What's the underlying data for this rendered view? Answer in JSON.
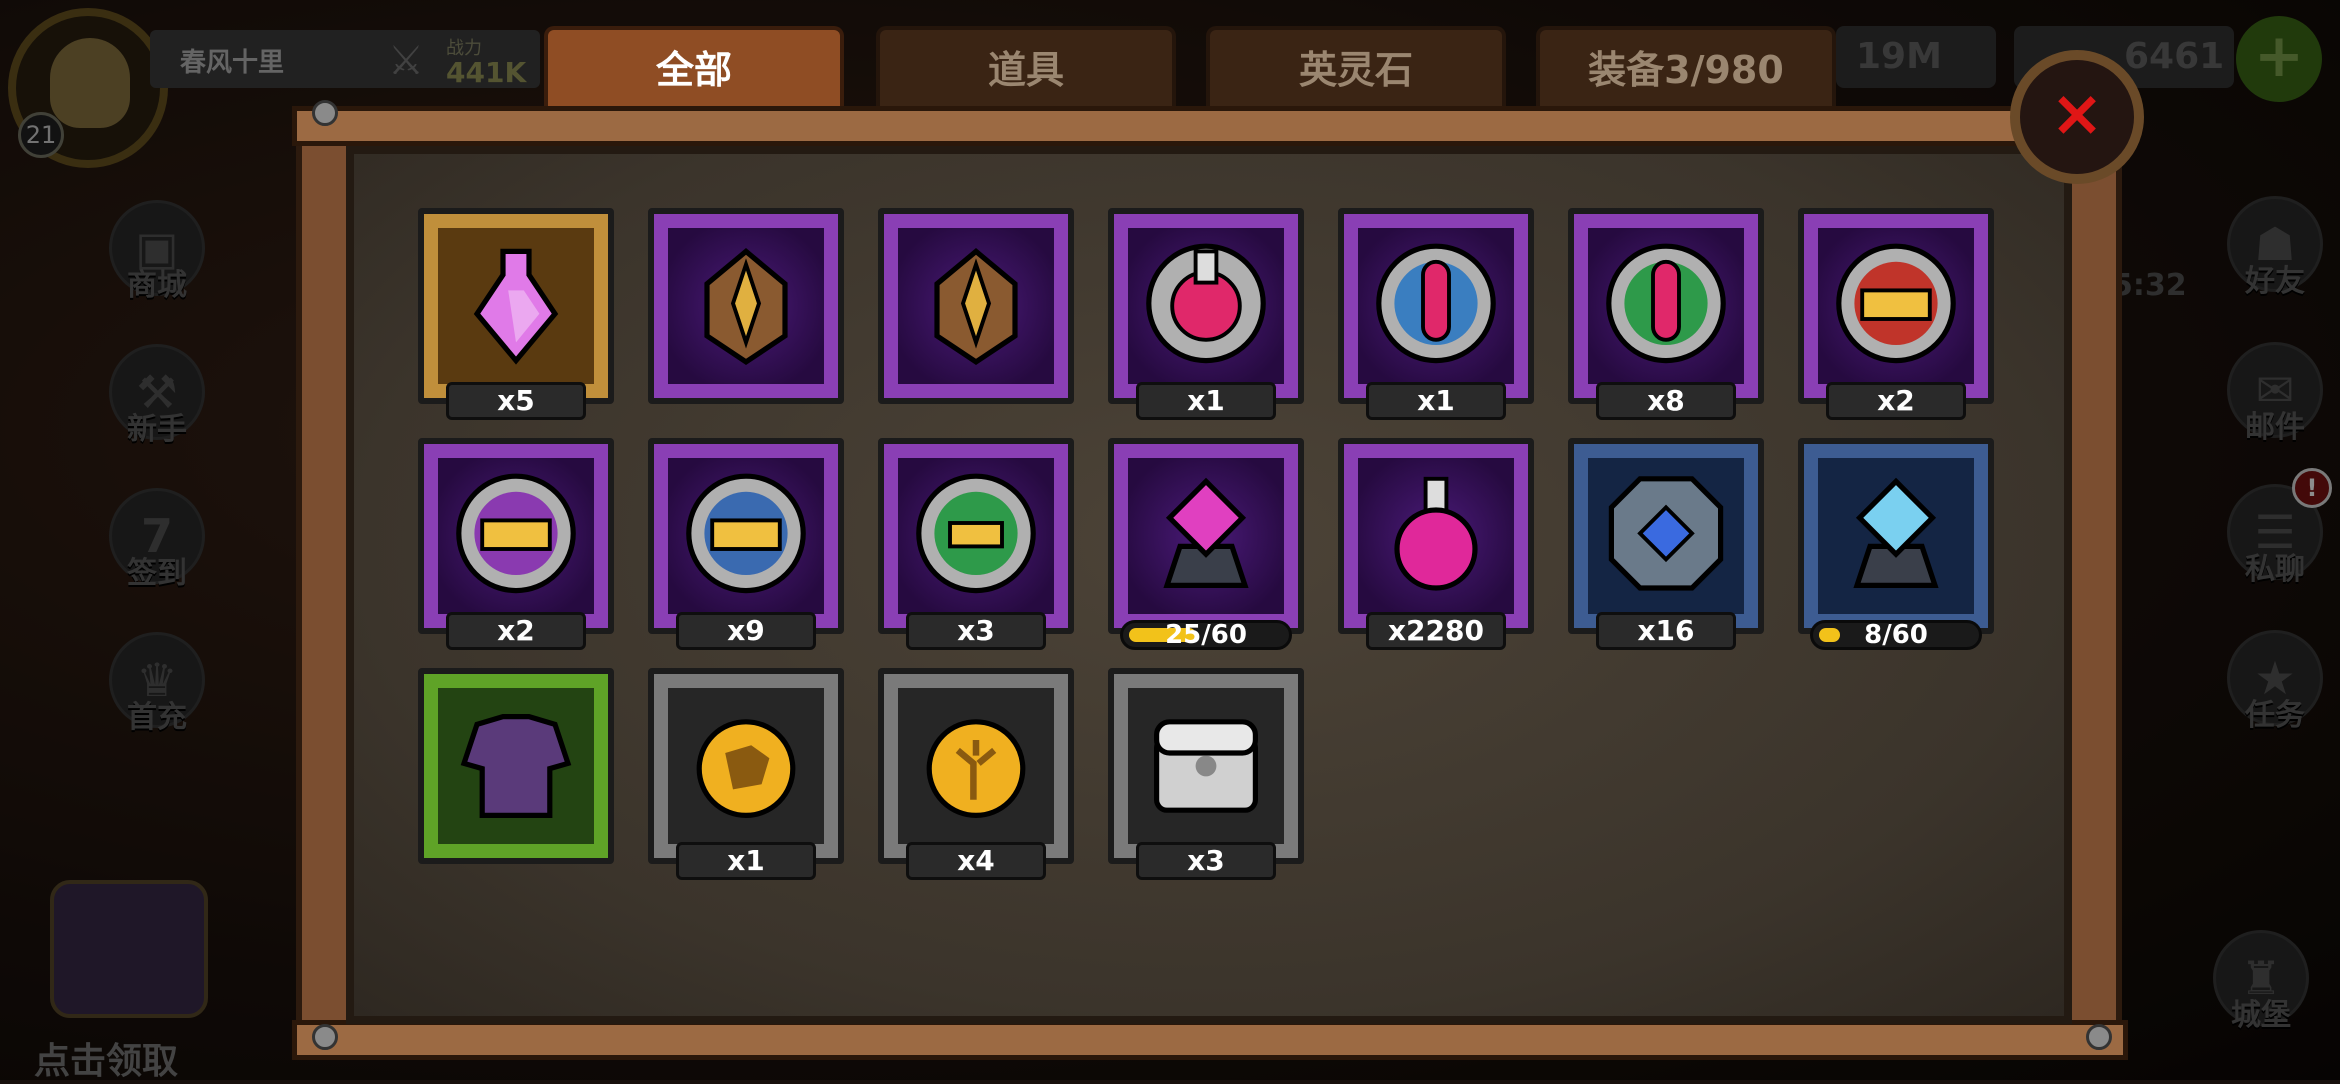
{
  "player": {
    "name": "春风十里",
    "level": "21",
    "power_label": "战力",
    "power_value": "441K"
  },
  "currency": {
    "amount_1": "19M",
    "amount_2": "6461",
    "plus": "+"
  },
  "side_left": [
    {
      "label": "商城",
      "icon": "shop-icon"
    },
    {
      "label": "新手",
      "icon": "hammer-icon"
    },
    {
      "label": "签到",
      "icon": "calendar-icon"
    },
    {
      "label": "首充",
      "icon": "first-charge-icon"
    }
  ],
  "side_right": [
    {
      "label": "好友",
      "icon": "friends-icon"
    },
    {
      "label": "邮件",
      "icon": "mail-icon"
    },
    {
      "label": "私聊",
      "icon": "chat-icon"
    },
    {
      "label": "任务",
      "icon": "quest-icon"
    },
    {
      "label": "城堡",
      "icon": "castle-icon"
    }
  ],
  "notice": "!",
  "timer": "5:32",
  "claim_label": "点击领取",
  "tabs": [
    {
      "label": "全部",
      "active": true
    },
    {
      "label": "道具",
      "active": false
    },
    {
      "label": "英灵石",
      "active": false
    },
    {
      "label": "装备3/980",
      "active": false
    }
  ],
  "close_label": "×",
  "colors": {
    "tab_active": "#8f4d24",
    "close": "#e01616",
    "progress": "#f2c21a"
  },
  "items": [
    {
      "icon": "pink-potion-icon",
      "frame": "gold",
      "count": "x5"
    },
    {
      "icon": "helmet-icon",
      "frame": "purple",
      "count": ""
    },
    {
      "icon": "helmet-icon",
      "frame": "purple",
      "count": ""
    },
    {
      "icon": "flask-badge-icon",
      "frame": "purple",
      "count": "x1"
    },
    {
      "icon": "test-tube-badge-icon",
      "frame": "purple",
      "count": "x1"
    },
    {
      "icon": "test-tube-green-badge-icon",
      "frame": "purple",
      "count": "x8"
    },
    {
      "icon": "gold-bars-red-badge-icon",
      "frame": "purple",
      "count": "x2"
    },
    {
      "icon": "gold-bars-purple-badge-icon",
      "frame": "purple",
      "count": "x2"
    },
    {
      "icon": "gold-bars-blue-badge-icon",
      "frame": "purple",
      "count": "x9"
    },
    {
      "icon": "gold-bar-green-badge-icon",
      "frame": "purple",
      "count": "x3"
    },
    {
      "icon": "pink-crystal-ore-icon",
      "frame": "purple",
      "progress": "25/60",
      "progress_value": 0.4167
    },
    {
      "icon": "pink-flask-icon",
      "frame": "purple",
      "count": "x2280"
    },
    {
      "icon": "rune-stone-icon",
      "frame": "blue",
      "count": "x16"
    },
    {
      "icon": "blue-crystal-ore-icon",
      "frame": "blue",
      "progress": "8/60",
      "progress_value": 0.1333
    },
    {
      "icon": "purple-armor-icon",
      "frame": "green",
      "count": ""
    },
    {
      "icon": "map-medal-icon",
      "frame": "grey",
      "count": "x1"
    },
    {
      "icon": "tree-medal-icon",
      "frame": "grey",
      "count": "x4"
    },
    {
      "icon": "silver-chest-icon",
      "frame": "grey",
      "count": "x3"
    }
  ]
}
